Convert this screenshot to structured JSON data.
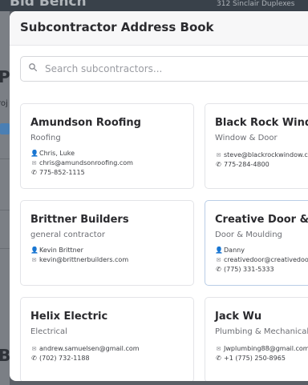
{
  "background": {
    "app_title": "Bid Bench",
    "header_address": "312 Sinclair Duplexes",
    "fragment_pr": "Pr",
    "fragment_roj": "roj",
    "fragment_bu": "Bu"
  },
  "modal": {
    "title": "Subcontractor Address Book",
    "search": {
      "placeholder": "Search subcontractors...",
      "value": ""
    }
  },
  "cards": [
    {
      "name": "Amundson Roofing",
      "trade": "Roofing",
      "contact": "Chris, Luke",
      "email": "chris@amundsonroofing.com",
      "phone": "775-852-1115"
    },
    {
      "name": "Black Rock Window & Door",
      "trade": "Window & Door",
      "contact": "",
      "email": "steve@blackrockwindow.com",
      "phone": "775-284-4800"
    },
    {
      "name": "Brittner Builders",
      "trade": "general contractor",
      "contact": "Kevin Brittner",
      "email": "kevin@brittnerbuilders.com",
      "phone": ""
    },
    {
      "name": "Creative Door & Moulding",
      "trade": "Door & Moulding",
      "contact": "Danny",
      "email": "creativedoor@creativedoor.com",
      "phone": "(775) 331-5333"
    },
    {
      "name": "Helix Electric",
      "trade": "Electrical",
      "contact": "",
      "email": "andrew.samuelsen@gmail.com",
      "phone": "(702) 732-1188"
    },
    {
      "name": "Jack Wu",
      "trade": "Plumbing & Mechanical",
      "contact": "",
      "email": "Jwplumbing88@gmail.com",
      "phone": "+1 (775) 250-8965"
    }
  ],
  "icons": {
    "person": "person-icon",
    "email": "email-icon",
    "phone": "phone-icon",
    "search": "search-icon"
  }
}
